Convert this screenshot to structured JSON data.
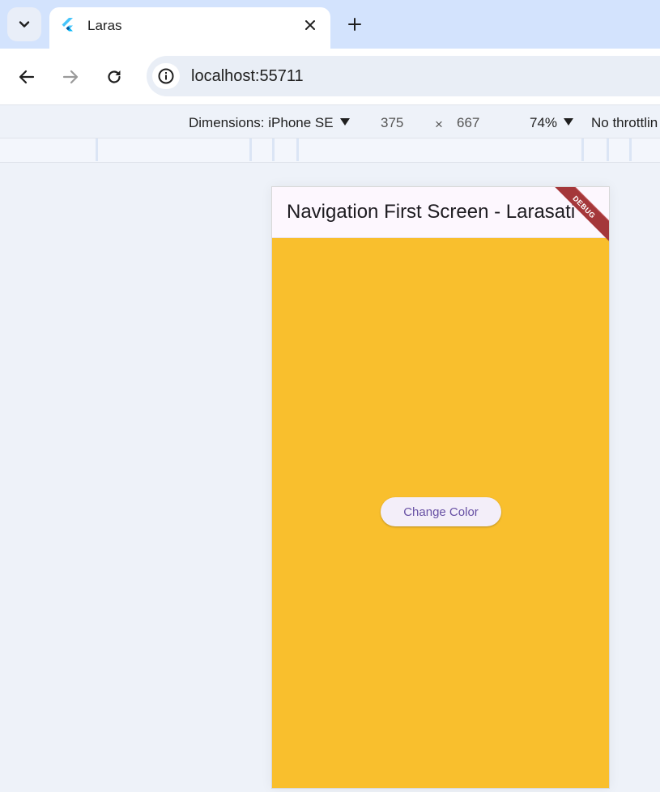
{
  "browser": {
    "tab": {
      "title": "Laras",
      "close_symbol": "✕"
    },
    "new_tab_symbol": "+",
    "url": "localhost:55711"
  },
  "devtools": {
    "dimensions_label": "Dimensions: iPhone SE",
    "width": "375",
    "times": "×",
    "height": "667",
    "zoom": "74%",
    "throttling": "No throttlin"
  },
  "app": {
    "appbar_title": "Navigation First Screen - Larasati",
    "debug_banner": "DEBUG",
    "button_label": "Change Color",
    "background_color": "#f9bf2d",
    "button_text_color": "#6750a4"
  },
  "icons": {
    "tab_search": "chevron-down-icon",
    "favicon": "flutter-icon",
    "back": "arrow-left-icon",
    "forward": "arrow-right-icon",
    "reload": "reload-icon",
    "site_info": "info-icon"
  }
}
